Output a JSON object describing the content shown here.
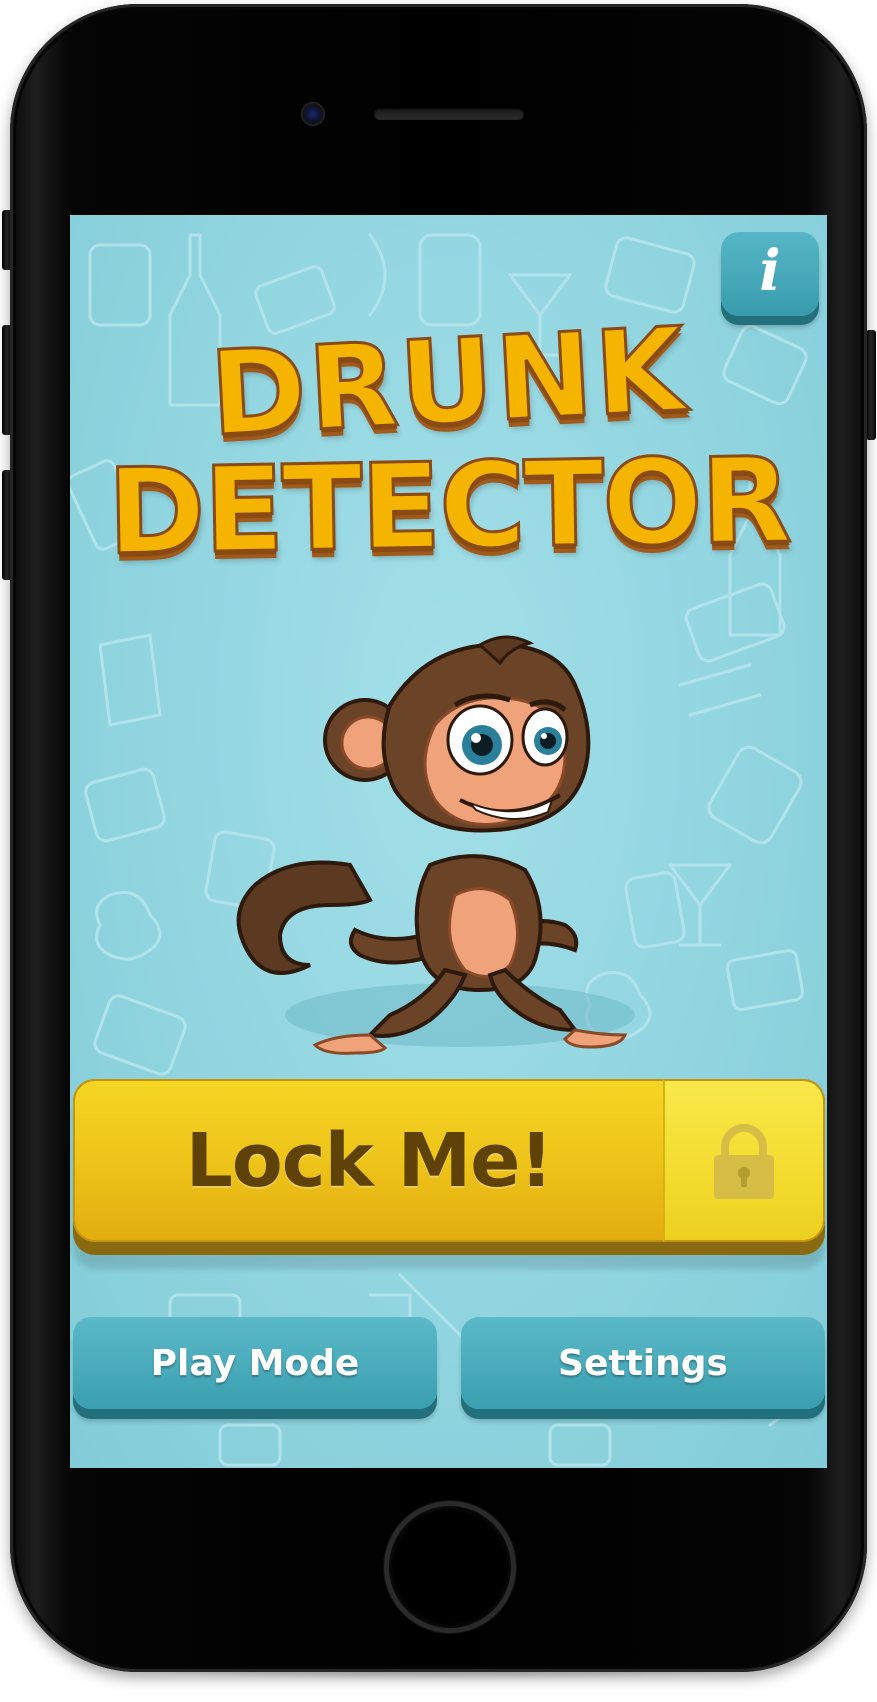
{
  "app": {
    "title_line1": "DRUNK",
    "title_line2": "DETECTOR"
  },
  "info_button": {
    "glyph": "i",
    "icon": "info-icon"
  },
  "hero": {
    "icon": "monkey-mascot-illustration"
  },
  "lock_button": {
    "label": "Lock Me!",
    "icon": "padlock-icon"
  },
  "bottom_buttons": {
    "play_mode_label": "Play Mode",
    "settings_label": "Settings"
  },
  "colors": {
    "background": "#8fd4df",
    "title_fill": "#f4b400",
    "title_outline": "#8a4a14",
    "lock_button": "#eec419",
    "lock_text": "#5f4208",
    "secondary_button": "#3a9fb0"
  }
}
